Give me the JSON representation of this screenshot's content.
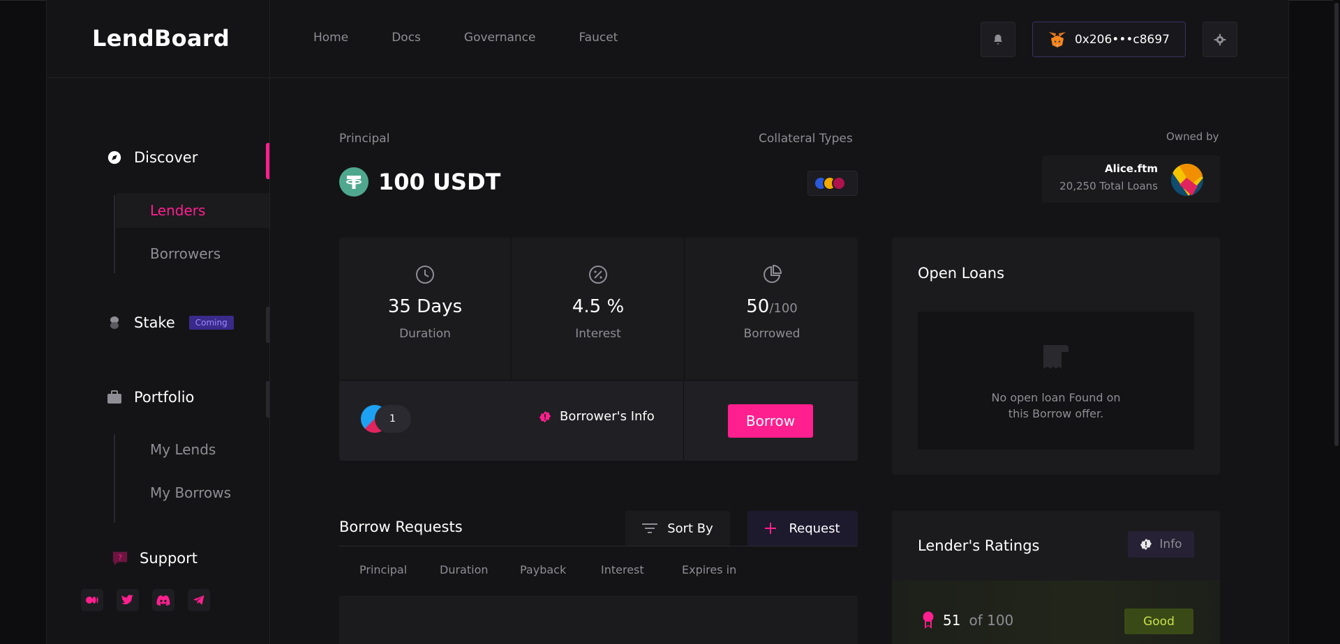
{
  "app": {
    "name": "LendBoard"
  },
  "nav": [
    "Home",
    "Docs",
    "Governance",
    "Faucet"
  ],
  "wallet": {
    "address": "0x206•••c8697"
  },
  "sidebar": {
    "discover": "Discover",
    "lenders": "Lenders",
    "borrowers": "Borrowers",
    "stake": "Stake",
    "coming": "Coming",
    "portfolio": "Portfolio",
    "my_lends": "My Lends",
    "my_borrows": "My Borrows",
    "support": "Support"
  },
  "offer": {
    "principal_label": "Principal",
    "principal_value": "100 USDT",
    "collateral_label": "Collateral Types",
    "owned_by_label": "Owned by",
    "owner_name": "Alice.ftm",
    "owner_loans": "20,250 Total Loans"
  },
  "stats": {
    "duration_value": "35 Days",
    "duration_label": "Duration",
    "interest_value": "4.5 %",
    "interest_label": "Interest",
    "borrowed_value": "50",
    "borrowed_total": "/100",
    "borrowed_label": "Borrowed",
    "borrower_count": "1",
    "borrower_info": "Borrower's Info",
    "borrow_button": "Borrow"
  },
  "open_loans": {
    "title": "Open Loans",
    "empty_line1": "No open loan Found on",
    "empty_line2": "this Borrow offer."
  },
  "borrow_requests": {
    "title": "Borrow Requests",
    "sort": "Sort By",
    "request": "Request",
    "columns": [
      "Principal",
      "Duration",
      "Payback",
      "Interest",
      "Expires in"
    ]
  },
  "ratings": {
    "title": "Lender's Ratings",
    "info": "Info",
    "score": "51",
    "out_of": "of 100",
    "grade": "Good"
  },
  "colors": {
    "accent": "#ff1f8e",
    "bg": "#141416",
    "card": "#1b1b1e"
  }
}
